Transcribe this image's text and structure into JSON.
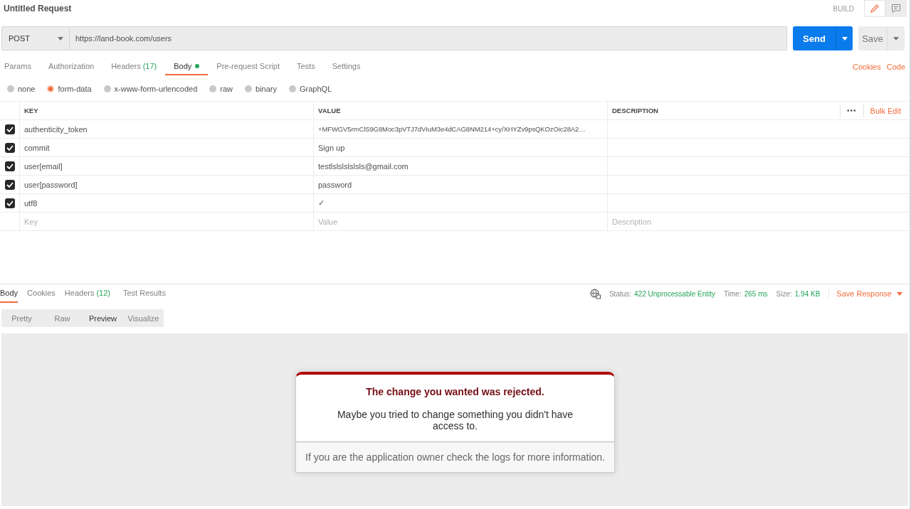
{
  "title": "Untitled Request",
  "mode": "BUILD",
  "method": "POST",
  "url": "https://land-book.com/users",
  "send": "Send",
  "save": "Save",
  "request_tabs": [
    {
      "label": "Params",
      "selected": false
    },
    {
      "label": "Authorization",
      "selected": false
    },
    {
      "label": "Headers",
      "count": "(17)",
      "selected": false
    },
    {
      "label": "Body",
      "has_content": true,
      "selected": true
    },
    {
      "label": "Pre-request Script",
      "selected": false
    },
    {
      "label": "Tests",
      "selected": false
    },
    {
      "label": "Settings",
      "selected": false
    }
  ],
  "links": [
    "Cookies",
    "Code"
  ],
  "body_types": [
    {
      "label": "none",
      "selected": false
    },
    {
      "label": "form-data",
      "selected": true
    },
    {
      "label": "x-www-form-urlencoded",
      "selected": false
    },
    {
      "label": "raw",
      "selected": false
    },
    {
      "label": "binary",
      "selected": false
    },
    {
      "label": "GraphQL",
      "selected": false
    }
  ],
  "table": {
    "columns": [
      "KEY",
      "VALUE",
      "DESCRIPTION"
    ],
    "more": "•••",
    "bulk_edit": "Bulk Edit",
    "rows": [
      {
        "checked": true,
        "key": "authenticity_token",
        "value": "+MFWGV5rmClS9G8Moc3pVTJ7dVIuM3e4dCAG8NM214+cy/XHYZv9psQKOzOic28A2…"
      },
      {
        "checked": true,
        "key": "commit",
        "value": "Sign up"
      },
      {
        "checked": true,
        "key": "user[email]",
        "value": "testlslslslslsls@gmail.com"
      },
      {
        "checked": true,
        "key": "user[password]",
        "value": "password"
      },
      {
        "checked": true,
        "key": "utf8",
        "value": "✓"
      }
    ],
    "new_row": {
      "key": {
        "placeholder": "Key"
      },
      "value": {
        "placeholder": "Value"
      },
      "description": {
        "placeholder": "Description"
      }
    }
  },
  "response_tabs": [
    {
      "label": "Body",
      "selected": true
    },
    {
      "label": "Cookies",
      "selected": false
    },
    {
      "label": "Headers",
      "count": "(12)",
      "selected": false
    },
    {
      "label": "Test Results",
      "selected": false
    }
  ],
  "response_meta": [
    {
      "label": "Status:",
      "value": "422 Unprocessable Entity"
    },
    {
      "label": "Time:",
      "value": "265 ms"
    },
    {
      "label": "Size:",
      "value": "1.94 KB"
    }
  ],
  "save_response": "Save Response",
  "view_modes": [
    {
      "label": "Pretty",
      "selected": false
    },
    {
      "label": "Raw",
      "selected": false
    },
    {
      "label": "Preview",
      "selected": true
    },
    {
      "label": "Visualize",
      "selected": false
    }
  ],
  "preview": {
    "heading": "The change you wanted was rejected.",
    "message": "Maybe you tried to change something you didn't have access to.",
    "footer": "If you are the application owner check the logs for more information."
  }
}
